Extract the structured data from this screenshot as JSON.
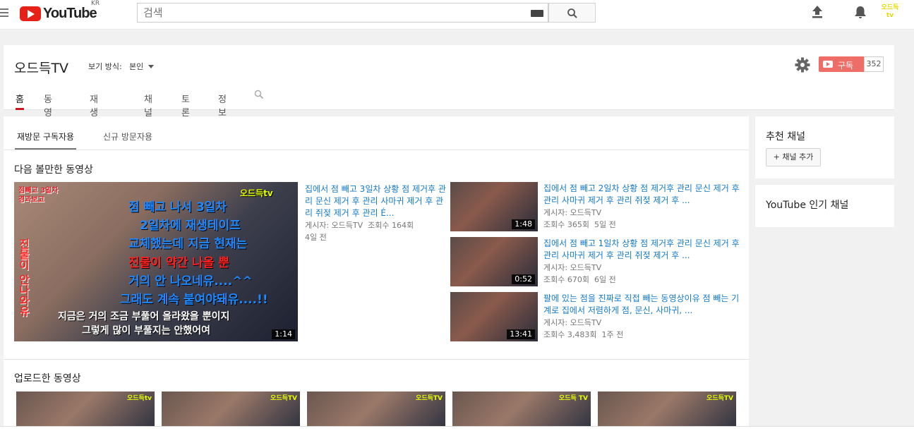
{
  "masthead": {
    "logo_text": "YouTube",
    "region": "KR",
    "search_placeholder": "검색",
    "avatar_text": "오드득tv"
  },
  "channel": {
    "title": "오드득TV",
    "view_as_label": "보기 방식:",
    "view_as_value": "본인",
    "subscribe_label": "구독",
    "subscriber_count": "352",
    "tabs": [
      {
        "label": "홈",
        "active": true
      },
      {
        "label": "동영상"
      },
      {
        "label": "재생목록"
      },
      {
        "label": "채널"
      },
      {
        "label": "토론"
      },
      {
        "label": "정보"
      }
    ]
  },
  "main": {
    "subtabs": [
      {
        "label": "재방문 구독자용",
        "active": true
      },
      {
        "label": "신규 방문자용"
      }
    ],
    "featured_section_title": "다음 볼만한 동영상",
    "featured": {
      "duration": "1:14",
      "title": "집에서 점 빼고 3일차 상황 점 제거후 관리 문신 제거 후 관리 사마귀 제거 후 관리 쥐젖 제거 후 관리 É...",
      "author": "게시자: 오드득TV",
      "views": "조회수 164회",
      "age": "4일 전",
      "thumb_texts": {
        "corner": "점빼고 3일차 경과보고",
        "brand": "오드득tv",
        "line1": "점 빼고 나서 3일차",
        "line2": "2일차에 재생테이프",
        "line3": "교체했는데 지금 현재는",
        "line4": "진물이 약간 나올 뿐",
        "line5": "거의 안 나오네유....^^",
        "line6": "그래도 계속 붙여야돼유....!!",
        "line7": "지금은 거의 조금 부풀어 올라왔을 뿐이지",
        "line8": "그렇게 많이 부풀지는 안했어여",
        "side": "진물이 안나와유"
      }
    },
    "list": [
      {
        "duration": "1:48",
        "title": "집에서 점 빼고 2일차 상황 점 제거후 관리 문신 제거 후 관리 사마귀 제거 후 관리 쥐젖 제거 후 ...",
        "author": "게시자: 오드득TV",
        "views": "조회수 365회",
        "age": "5일 전"
      },
      {
        "duration": "0:52",
        "title": "집에서 점 빼고 1일차 상황 점 제거후 관리 문신 제거 후 관리 사마귀 제거 후 관리 쥐젖 제거 후 ...",
        "author": "게시자: 오드득TV",
        "views": "조회수 670회",
        "age": "6일 전"
      },
      {
        "duration": "13:41",
        "title": "팔에 있는 점을 진짜로 직접 빼는 동영상이유 점 빼는 기계로 집에서 저렴하게 점, 문신, 사마귀, ...",
        "author": "게시자: 오드득TV",
        "views": "조회수 3,483회",
        "age": "1주 전"
      }
    ],
    "uploads_section_title": "업로드한 동영상",
    "upload_thumb_labels": [
      "오드득tv",
      "오드득TV",
      "오드득TV",
      "오드득 TV",
      "오드득TV"
    ]
  },
  "sidebar": {
    "recommended_title": "추천 채널",
    "add_channel_label": "+ 채널 추가",
    "popular_title": "YouTube 인기 채널"
  },
  "colors": {
    "brand_red": "#e62117",
    "link_blue": "#167ac6",
    "tab_underline": "#cc181e"
  }
}
